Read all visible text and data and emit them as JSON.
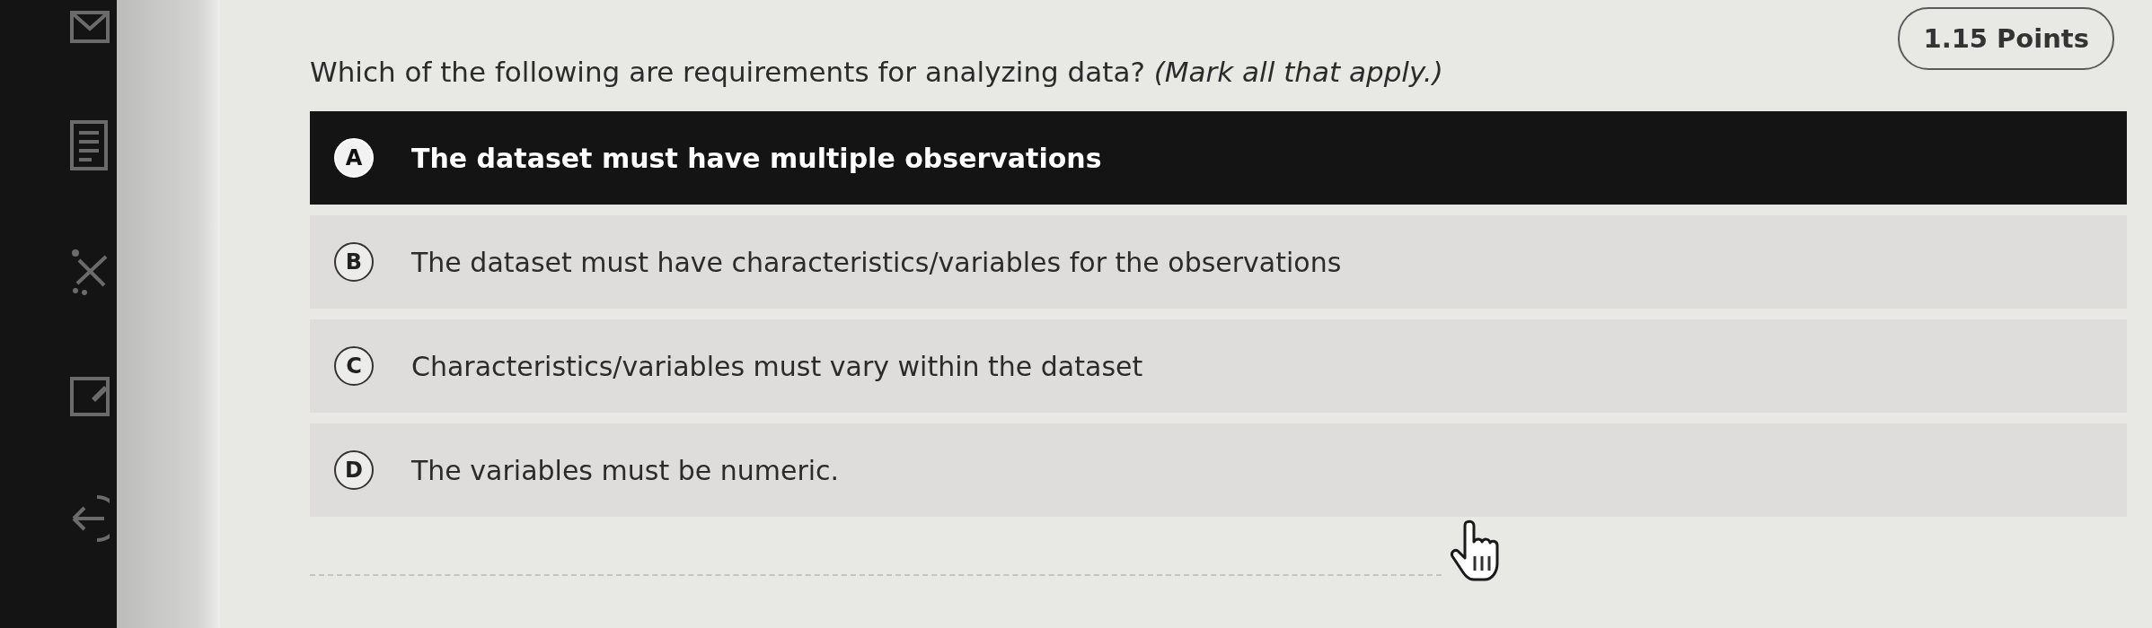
{
  "points": "1.15 Points",
  "question": {
    "text": "Which of the following are requirements for analyzing data? *(Mark all that apply.)*"
  },
  "options": [
    {
      "letter": "A",
      "text": "The dataset must have multiple observations",
      "selected": true
    },
    {
      "letter": "B",
      "text": "The dataset must have characteristics/variables for the observations",
      "selected": false
    },
    {
      "letter": "C",
      "text": "Characteristics/variables must vary within the dataset",
      "selected": false
    },
    {
      "letter": "D",
      "text": "The variables must be numeric.",
      "selected": false
    }
  ]
}
